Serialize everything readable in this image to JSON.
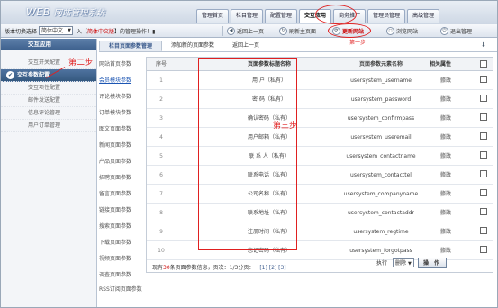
{
  "app": {
    "logo_en": "WEB",
    "logo_cn": "网站管理系统"
  },
  "nav": {
    "tabs": [
      "管理首页",
      "栏目管理",
      "配置管理",
      "交互应用",
      "商务推广",
      "管理员管理",
      "高级管理"
    ],
    "active": "交互应用"
  },
  "toolbar": {
    "lang_label": "版本切换选择",
    "lang_value": "简体中文",
    "info_prefix": "入【",
    "info_site": "简体中文版",
    "info_suffix": "】的管理操作！",
    "back": "返回上一页",
    "refresh": "刷新主页面",
    "update_site": "更新网站",
    "browse_site": "浏览网站",
    "logout": "退出管理"
  },
  "sidebar": {
    "heading": "交互应用",
    "items": [
      "交互开关配置",
      "交互参数配置",
      "交互项性配置",
      "邮件发送配置",
      "信息评论管理",
      "用户订单管理"
    ],
    "active_index": 1
  },
  "subtabs": [
    "栏目页面参数管理",
    "添加新的页面参数",
    "返回上一页"
  ],
  "modules": [
    "网站首页参数",
    "会员模块参数",
    "评论模块参数",
    "订单模块参数",
    "图文页面参数",
    "新闻页面参数",
    "产品页面参数",
    "招聘页面参数",
    "留言页面参数",
    "链接页面参数",
    "搜索页面参数",
    "下载页面参数",
    "视频页面参数",
    "调查页面参数",
    "RSS订阅页面参数"
  ],
  "modules_active_index": 1,
  "table": {
    "headers": {
      "no": "序号",
      "name": "页面参数标题名称",
      "key": "页面参数元素名称",
      "attr": "相关属性"
    },
    "rows": [
      {
        "no": "1",
        "name": "用 户（私有）",
        "key": "usersystem_username",
        "edit": "修改",
        "del": "删除"
      },
      {
        "no": "2",
        "name": "密 码（私有）",
        "key": "usersystem_password",
        "edit": "修改",
        "del": "删除"
      },
      {
        "no": "3",
        "name": "确认密码（私有）",
        "key": "usersystem_confirmpass",
        "edit": "修改",
        "del": "删除"
      },
      {
        "no": "4",
        "name": "用户邮箱（私有）",
        "key": "usersystem_useremail",
        "edit": "修改",
        "del": "删除"
      },
      {
        "no": "5",
        "name": "联 系 人（私有）",
        "key": "usersystem_contactname",
        "edit": "修改",
        "del": "删除"
      },
      {
        "no": "6",
        "name": "联系电话（私有）",
        "key": "usersystem_contacttel",
        "edit": "修改",
        "del": "删除"
      },
      {
        "no": "7",
        "name": "公司名称（私有）",
        "key": "usersystem_companyname",
        "edit": "修改",
        "del": "删除"
      },
      {
        "no": "8",
        "name": "联系地址（私有）",
        "key": "usersystem_contactaddr",
        "edit": "修改",
        "del": "删除"
      },
      {
        "no": "9",
        "name": "注册时间（私有）",
        "key": "usersystem_regtime",
        "edit": "修改",
        "del": "删除"
      },
      {
        "no": "10",
        "name": "忘记密码（私有）",
        "key": "usersystem_forgotpass",
        "edit": "修改",
        "del": "删除"
      }
    ],
    "footer_prefix": "现有",
    "footer_count": "30",
    "footer_suffix": "条页面参数信息，页次：1/3分页：",
    "pages": "[1] [2] [3]"
  },
  "actions": {
    "label": "执行",
    "select_value": "删除",
    "button": "操 作"
  },
  "annotations": {
    "step1": "第一步",
    "step2": "第二步",
    "step3": "第三步"
  },
  "colors": {
    "annotation": "#e02020",
    "active_sidebar": "#35597f"
  }
}
